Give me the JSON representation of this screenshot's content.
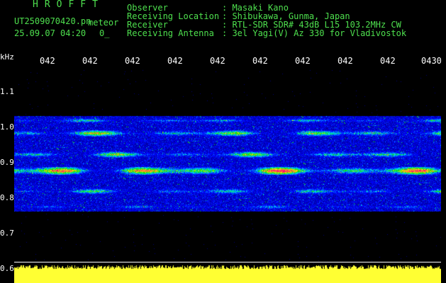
{
  "brand": "HROFFT",
  "file_name": "UT2509070420.pn",
  "meteor_label": "meteor",
  "date_time": "25.09.07 04:20",
  "counter": "0_",
  "info": {
    "observer_label": "Observer",
    "observer_value": ": Masaki Kano",
    "location_label": "Receiving Location",
    "location_value": ": Shibukawa, Gunma, Japan",
    "receiver_label": "Receiver",
    "receiver_value": ": RTL-SDR SDR# 43dB L15 103.2MHz CW",
    "antenna_label": "Receiving Antenna",
    "antenna_value": ": 3el Yagi(V) Az 330 for Vladivostok"
  },
  "axis": {
    "unit": "kHz",
    "x_ticks": [
      "042",
      "042",
      "042",
      "042",
      "042",
      "042",
      "042",
      "042",
      "042",
      "0430"
    ],
    "y_ticks": [
      "1.1",
      "1.0",
      "0.9",
      "0.8",
      "0.7",
      "0.6"
    ]
  },
  "colors": {
    "header_text": "#4ee04e",
    "axis_text": "#ffffff",
    "signal_bar": "#ffff33",
    "background": "#000000"
  }
}
